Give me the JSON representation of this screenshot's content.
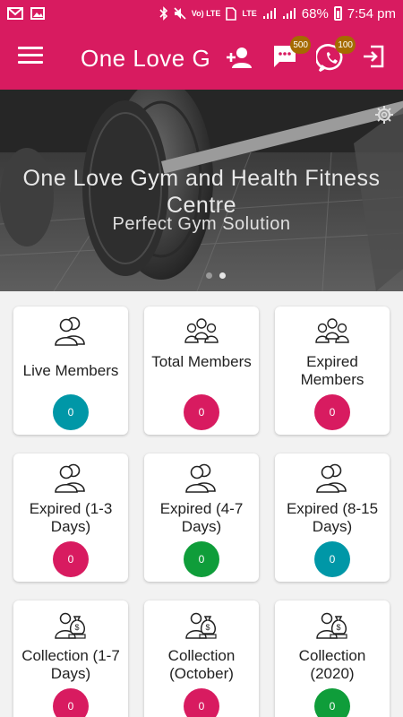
{
  "status_bar": {
    "network": "LTE",
    "volte": "Vo) LTE",
    "battery": "68%",
    "time": "7:54 pm"
  },
  "app_bar": {
    "title": "One Love Gym and Health Fitness Centre",
    "messages_badge": "500",
    "whatsapp_badge": "100"
  },
  "banner": {
    "title": "One Love Gym and Health Fitness Centre",
    "subtitle": "Perfect Gym Solution"
  },
  "colors": {
    "primary": "#d81b60",
    "pink": "#d81b60",
    "teal": "#0097a7",
    "green": "#0f9d3a"
  },
  "cards": [
    {
      "label": "Live Members",
      "count": "0",
      "color": "teal",
      "icon": "person-pair-icon"
    },
    {
      "label": "Total Members",
      "count": "0",
      "color": "pink",
      "icon": "group-icon"
    },
    {
      "label": "Expired Members",
      "count": "0",
      "color": "pink",
      "icon": "group-icon"
    },
    {
      "label": "Expired (1-3 Days)",
      "count": "0",
      "color": "pink",
      "icon": "person-pair-icon"
    },
    {
      "label": "Expired (4-7 Days)",
      "count": "0",
      "color": "green",
      "icon": "person-pair-icon"
    },
    {
      "label": "Expired (8-15 Days)",
      "count": "0",
      "color": "teal",
      "icon": "person-pair-icon"
    },
    {
      "label": "Collection (1-7 Days)",
      "count": "0",
      "color": "pink",
      "icon": "money-bag-person-icon"
    },
    {
      "label": "Collection (October)",
      "count": "0",
      "color": "pink",
      "icon": "money-bag-person-icon"
    },
    {
      "label": "Collection (2020)",
      "count": "0",
      "color": "green",
      "icon": "money-bag-person-icon"
    }
  ]
}
